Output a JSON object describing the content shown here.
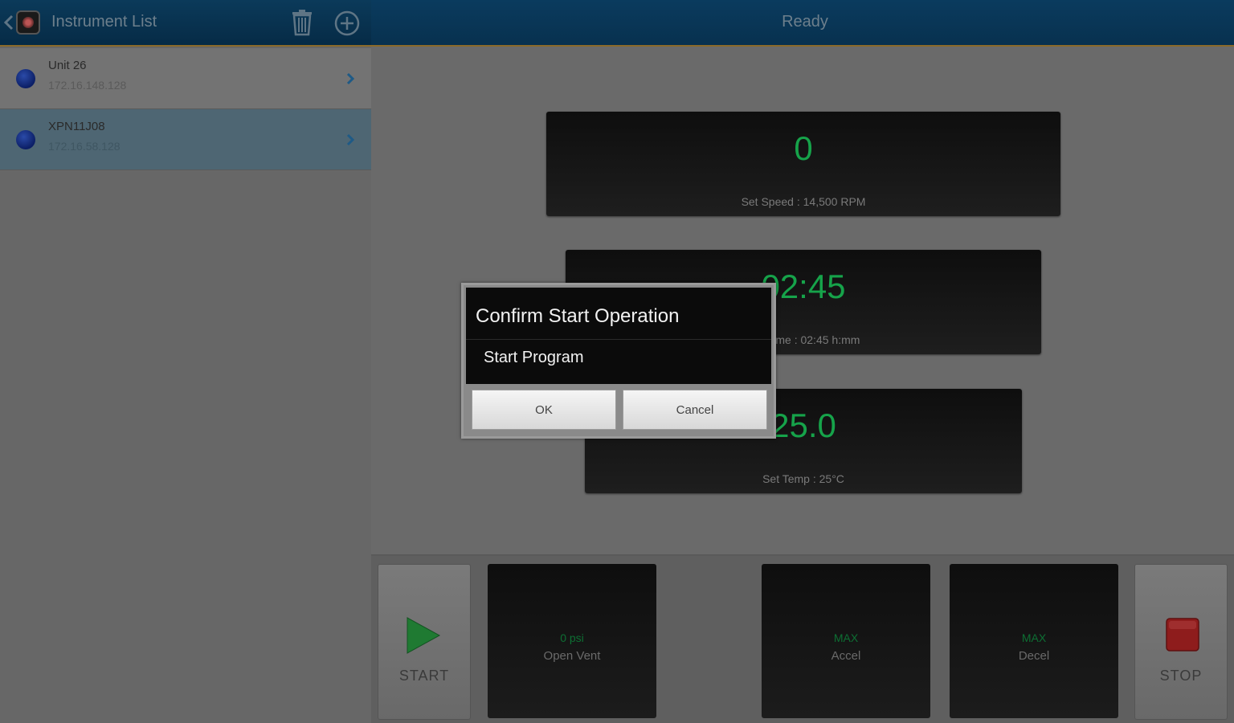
{
  "left_header": {
    "title": "Instrument List"
  },
  "instruments": [
    {
      "name": "Unit 26",
      "ip": "172.16.148.128",
      "selected": false
    },
    {
      "name": "XPN11J08",
      "ip": "172.16.58.128",
      "selected": true
    }
  ],
  "right_header": {
    "status": "Ready"
  },
  "readouts": {
    "speed": {
      "value": "0",
      "label": "Set Speed : 14,500 RPM"
    },
    "time": {
      "value": "02:45",
      "label": "Set Time : 02:45 h:mm"
    },
    "temp": {
      "value": "25.0",
      "label": "Set Temp : 25°C"
    }
  },
  "controls": {
    "start_label": "START",
    "stop_label": "STOP",
    "vent": {
      "value": "0 psi",
      "label": "Open Vent"
    },
    "accel": {
      "value": "MAX",
      "label": "Accel"
    },
    "decel": {
      "value": "MAX",
      "label": "Decel"
    }
  },
  "dialog": {
    "title": "Confirm Start Operation",
    "message": "Start Program",
    "ok_label": "OK",
    "cancel_label": "Cancel"
  },
  "colors": {
    "readout_green": "#16a34a",
    "header_blue": "#0a3b5e",
    "dot_blue": "#1a3a99"
  },
  "icons": [
    "back-icon",
    "app-logo",
    "trash-icon",
    "add-icon",
    "chevron-right-icon",
    "play-icon",
    "stop-icon"
  ]
}
